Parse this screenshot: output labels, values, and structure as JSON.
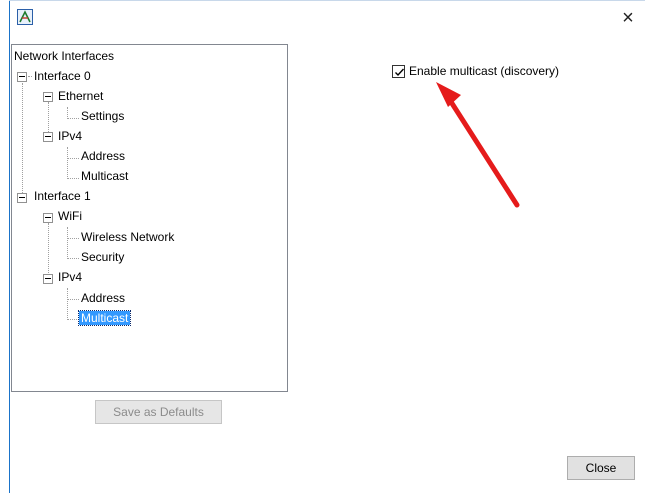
{
  "window": {
    "close_glyph": "×"
  },
  "tree": {
    "root": "Network Interfaces",
    "interface0": {
      "label": "Interface 0",
      "ethernet": "Ethernet",
      "settings": "Settings",
      "ipv4": "IPv4",
      "address": "Address",
      "multicast": "Multicast"
    },
    "interface1": {
      "label": "Interface 1",
      "wifi": "WiFi",
      "wireless_network": "Wireless Network",
      "security": "Security",
      "ipv4": "IPv4",
      "address": "Address",
      "multicast": "Multicast"
    },
    "selected": "Multicast"
  },
  "settings": {
    "enable_multicast_label": "Enable multicast (discovery)",
    "enable_multicast_checked": true
  },
  "buttons": {
    "save_defaults": "Save as Defaults",
    "close": "Close"
  },
  "colors": {
    "selection": "#3399ff",
    "annotation_arrow": "#e51b1b",
    "window_border": "#1a73c9"
  },
  "icons": {
    "app": "app-logo-icon",
    "close": "close-icon",
    "check": "checkmark-icon",
    "annotation": "red-arrow-annotation"
  }
}
